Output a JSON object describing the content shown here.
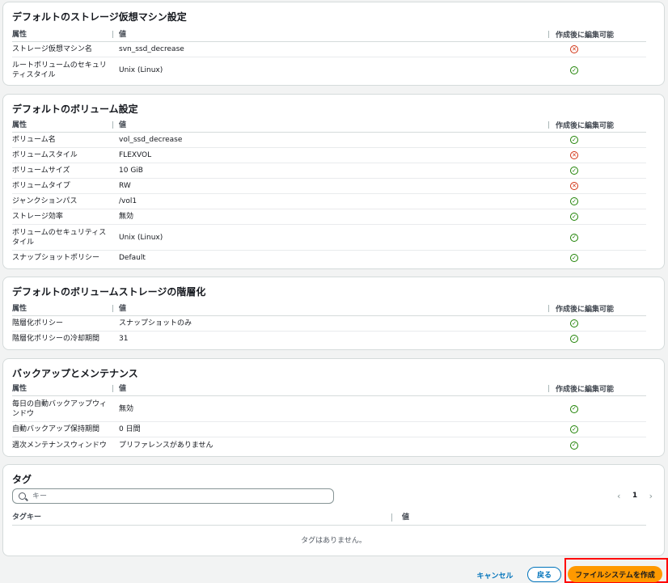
{
  "svm_section": {
    "title": "デフォルトのストレージ仮想マシン設定",
    "headers": {
      "attr": "属性",
      "value": "値",
      "editable": "作成後に編集可能"
    },
    "rows": [
      {
        "attr": "ストレージ仮想マシン名",
        "value": "svn_ssd_decrease",
        "editable": false
      },
      {
        "attr": "ルートボリュームのセキュリティスタイル",
        "value": "Unix (Linux)",
        "editable": true
      }
    ]
  },
  "volume_section": {
    "title": "デフォルトのボリューム設定",
    "headers": {
      "attr": "属性",
      "value": "値",
      "editable": "作成後に編集可能"
    },
    "rows": [
      {
        "attr": "ボリューム名",
        "value": "vol_ssd_decrease",
        "editable": true
      },
      {
        "attr": "ボリュームスタイル",
        "value": "FLEXVOL",
        "editable": false
      },
      {
        "attr": "ボリュームサイズ",
        "value": "10 GiB",
        "editable": true
      },
      {
        "attr": "ボリュームタイプ",
        "value": "RW",
        "editable": false
      },
      {
        "attr": "ジャンクションパス",
        "value": "/vol1",
        "editable": true
      },
      {
        "attr": "ストレージ効率",
        "value": "無効",
        "editable": true
      },
      {
        "attr": "ボリュームのセキュリティスタイル",
        "value": "Unix (Linux)",
        "editable": true
      },
      {
        "attr": "スナップショットポリシー",
        "value": "Default",
        "editable": true
      }
    ]
  },
  "tiering_section": {
    "title": "デフォルトのボリュームストレージの階層化",
    "headers": {
      "attr": "属性",
      "value": "値",
      "editable": "作成後に編集可能"
    },
    "rows": [
      {
        "attr": "階層化ポリシー",
        "value": "スナップショットのみ",
        "editable": true
      },
      {
        "attr": "階層化ポリシーの冷却期間",
        "value": "31",
        "editable": true
      }
    ]
  },
  "backup_section": {
    "title": "バックアップとメンテナンス",
    "headers": {
      "attr": "属性",
      "value": "値",
      "editable": "作成後に編集可能"
    },
    "rows": [
      {
        "attr": "毎日の自動バックアップウィンドウ",
        "value": "無効",
        "editable": true
      },
      {
        "attr": "自動バックアップ保持期間",
        "value": "0 日間",
        "editable": true
      },
      {
        "attr": "週次メンテナンスウィンドウ",
        "value": "プリファレンスがありません",
        "editable": true
      }
    ]
  },
  "tags_section": {
    "title": "タグ",
    "search_placeholder": "キー",
    "page": "1",
    "columns": {
      "key": "タグキー",
      "value": "値"
    },
    "empty_message": "タグはありません。"
  },
  "footer": {
    "cancel_label": "キャンセル",
    "back_label": "戻る",
    "create_label": "ファイルシステムを作成"
  },
  "colors": {
    "ok": "#1d8102",
    "ng": "#d13212",
    "primary": "#ff9900",
    "link": "#0073bb",
    "highlight_box": "#ff0000"
  },
  "icons": {
    "editable_yes": "check-circle-icon",
    "editable_no": "x-circle-icon",
    "search": "search-icon"
  }
}
